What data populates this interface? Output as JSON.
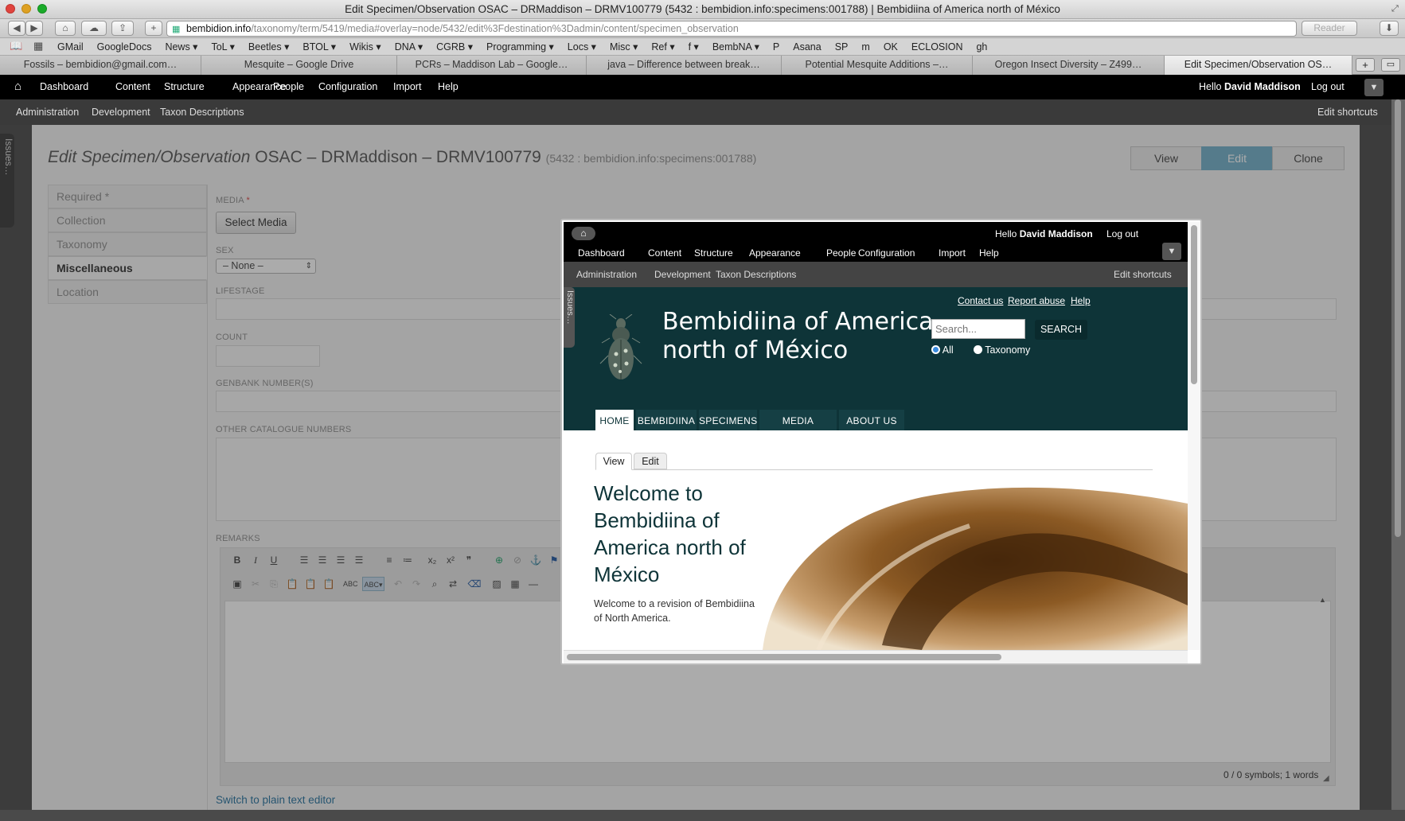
{
  "window": {
    "title": "Edit Specimen/Observation OSAC – DRMaddison – DRMV100779 (5432 : bembidion.info:specimens:001788) | Bembidiina of America north of México"
  },
  "browser": {
    "url_domain": "bembidion.info",
    "url_path": "/taxonomy/term/5419/media#overlay=node/5432/edit%3Fdestination%3Dadmin/content/specimen_observation",
    "reader_label": "Reader",
    "bookmarks": [
      "GMail",
      "GoogleDocs",
      "News ▾",
      "ToL ▾",
      "Beetles ▾",
      "BTOL ▾",
      "Wikis ▾",
      "DNA ▾",
      "CGRB ▾",
      "Programming ▾",
      "Locs ▾",
      "Misc ▾",
      "Ref ▾",
      "f ▾",
      "BembNA ▾",
      "P",
      "Asana",
      "SP",
      "m",
      "OK",
      "ECLOSION",
      "gh"
    ],
    "tabs": [
      "Fossils – bembidion@gmail.com…",
      "Mesquite – Google Drive",
      "PCRs – Maddison Lab – Google…",
      "java – Difference between break…",
      "Potential Mesquite Additions –…",
      "Oregon Insect Diversity – Z499…",
      "Edit Specimen/Observation OS…"
    ]
  },
  "admin_toolbar": {
    "menu": [
      "Dashboard",
      "Content",
      "Structure",
      "Appearance",
      "People",
      "Configuration",
      "Import",
      "Help"
    ],
    "hello_prefix": "Hello ",
    "user": "David Maddison",
    "logout": "Log out",
    "shortcuts": [
      "Administration",
      "Development",
      "Taxon Descriptions"
    ],
    "edit_shortcuts": "Edit shortcuts"
  },
  "issues_tab": "Issues…",
  "page": {
    "title_italic": "Edit Specimen/Observation",
    "title_rest": " OSAC – DRMaddison – DRMV100779",
    "title_small": "(5432 : bembidion.info:specimens:001788)",
    "view_btn": "View",
    "edit_btn": "Edit",
    "clone_btn": "Clone",
    "vtabs": [
      "Required *",
      "Collection",
      "Taxonomy",
      "Miscellaneous",
      "Location"
    ],
    "fields": {
      "media_label": "MEDIA",
      "media_req": "*",
      "select_media": "Select Media",
      "sex_label": "SEX",
      "sex_value": "– None –",
      "lifestage_label": "LIFESTAGE",
      "count_label": "COUNT",
      "genbank_label": "GENBANK NUMBER(S)",
      "other_label": "OTHER CATALOGUE NUMBERS",
      "remarks_label": "REMARKS",
      "symbols": "0 / 0 symbols; 1 words",
      "switch_editor": "Switch to plain text editor"
    }
  },
  "modal": {
    "site_title_line1": "Bembidiina of America",
    "site_title_line2": "north of México",
    "links": [
      "Contact us",
      "Report abuse",
      "Help"
    ],
    "search_placeholder": "Search...",
    "search_btn": "SEARCH",
    "radio_all": "All",
    "radio_taxonomy": "Taxonomy",
    "nav": [
      "HOME",
      "BEMBIDIINA",
      "SPECIMENS",
      "MEDIA GALLERY",
      "ABOUT US"
    ],
    "content_tabs": [
      "View",
      "Edit"
    ],
    "welcome_heading": [
      "Welcome to",
      "Bembidiina of",
      "America north of",
      "México"
    ],
    "welcome_text_1": "Welcome to a revision of Bembidiina",
    "welcome_text_2": "of North America."
  }
}
